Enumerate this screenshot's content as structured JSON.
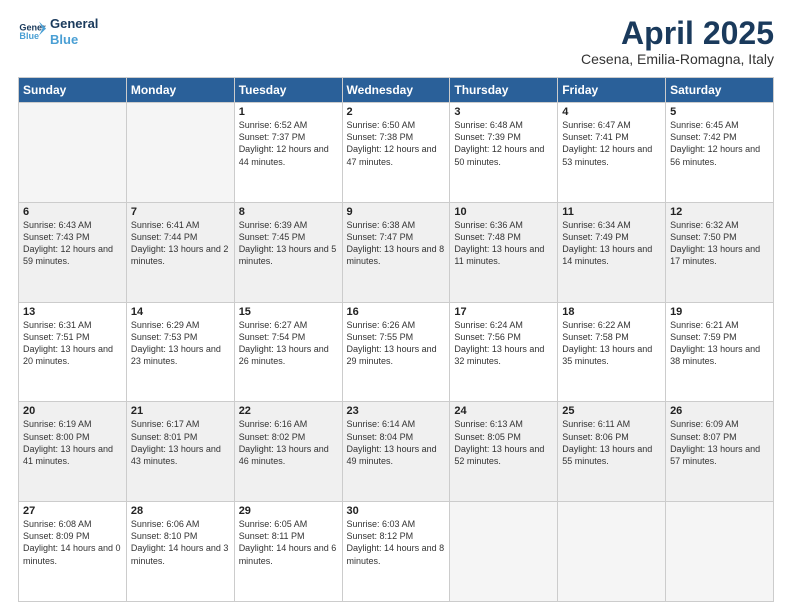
{
  "header": {
    "logo_general": "General",
    "logo_blue": "Blue",
    "month_title": "April 2025",
    "location": "Cesena, Emilia-Romagna, Italy"
  },
  "days_of_week": [
    "Sunday",
    "Monday",
    "Tuesday",
    "Wednesday",
    "Thursday",
    "Friday",
    "Saturday"
  ],
  "weeks": [
    [
      {
        "day": "",
        "info": ""
      },
      {
        "day": "",
        "info": ""
      },
      {
        "day": "1",
        "info": "Sunrise: 6:52 AM\nSunset: 7:37 PM\nDaylight: 12 hours and 44 minutes."
      },
      {
        "day": "2",
        "info": "Sunrise: 6:50 AM\nSunset: 7:38 PM\nDaylight: 12 hours and 47 minutes."
      },
      {
        "day": "3",
        "info": "Sunrise: 6:48 AM\nSunset: 7:39 PM\nDaylight: 12 hours and 50 minutes."
      },
      {
        "day": "4",
        "info": "Sunrise: 6:47 AM\nSunset: 7:41 PM\nDaylight: 12 hours and 53 minutes."
      },
      {
        "day": "5",
        "info": "Sunrise: 6:45 AM\nSunset: 7:42 PM\nDaylight: 12 hours and 56 minutes."
      }
    ],
    [
      {
        "day": "6",
        "info": "Sunrise: 6:43 AM\nSunset: 7:43 PM\nDaylight: 12 hours and 59 minutes."
      },
      {
        "day": "7",
        "info": "Sunrise: 6:41 AM\nSunset: 7:44 PM\nDaylight: 13 hours and 2 minutes."
      },
      {
        "day": "8",
        "info": "Sunrise: 6:39 AM\nSunset: 7:45 PM\nDaylight: 13 hours and 5 minutes."
      },
      {
        "day": "9",
        "info": "Sunrise: 6:38 AM\nSunset: 7:47 PM\nDaylight: 13 hours and 8 minutes."
      },
      {
        "day": "10",
        "info": "Sunrise: 6:36 AM\nSunset: 7:48 PM\nDaylight: 13 hours and 11 minutes."
      },
      {
        "day": "11",
        "info": "Sunrise: 6:34 AM\nSunset: 7:49 PM\nDaylight: 13 hours and 14 minutes."
      },
      {
        "day": "12",
        "info": "Sunrise: 6:32 AM\nSunset: 7:50 PM\nDaylight: 13 hours and 17 minutes."
      }
    ],
    [
      {
        "day": "13",
        "info": "Sunrise: 6:31 AM\nSunset: 7:51 PM\nDaylight: 13 hours and 20 minutes."
      },
      {
        "day": "14",
        "info": "Sunrise: 6:29 AM\nSunset: 7:53 PM\nDaylight: 13 hours and 23 minutes."
      },
      {
        "day": "15",
        "info": "Sunrise: 6:27 AM\nSunset: 7:54 PM\nDaylight: 13 hours and 26 minutes."
      },
      {
        "day": "16",
        "info": "Sunrise: 6:26 AM\nSunset: 7:55 PM\nDaylight: 13 hours and 29 minutes."
      },
      {
        "day": "17",
        "info": "Sunrise: 6:24 AM\nSunset: 7:56 PM\nDaylight: 13 hours and 32 minutes."
      },
      {
        "day": "18",
        "info": "Sunrise: 6:22 AM\nSunset: 7:58 PM\nDaylight: 13 hours and 35 minutes."
      },
      {
        "day": "19",
        "info": "Sunrise: 6:21 AM\nSunset: 7:59 PM\nDaylight: 13 hours and 38 minutes."
      }
    ],
    [
      {
        "day": "20",
        "info": "Sunrise: 6:19 AM\nSunset: 8:00 PM\nDaylight: 13 hours and 41 minutes."
      },
      {
        "day": "21",
        "info": "Sunrise: 6:17 AM\nSunset: 8:01 PM\nDaylight: 13 hours and 43 minutes."
      },
      {
        "day": "22",
        "info": "Sunrise: 6:16 AM\nSunset: 8:02 PM\nDaylight: 13 hours and 46 minutes."
      },
      {
        "day": "23",
        "info": "Sunrise: 6:14 AM\nSunset: 8:04 PM\nDaylight: 13 hours and 49 minutes."
      },
      {
        "day": "24",
        "info": "Sunrise: 6:13 AM\nSunset: 8:05 PM\nDaylight: 13 hours and 52 minutes."
      },
      {
        "day": "25",
        "info": "Sunrise: 6:11 AM\nSunset: 8:06 PM\nDaylight: 13 hours and 55 minutes."
      },
      {
        "day": "26",
        "info": "Sunrise: 6:09 AM\nSunset: 8:07 PM\nDaylight: 13 hours and 57 minutes."
      }
    ],
    [
      {
        "day": "27",
        "info": "Sunrise: 6:08 AM\nSunset: 8:09 PM\nDaylight: 14 hours and 0 minutes."
      },
      {
        "day": "28",
        "info": "Sunrise: 6:06 AM\nSunset: 8:10 PM\nDaylight: 14 hours and 3 minutes."
      },
      {
        "day": "29",
        "info": "Sunrise: 6:05 AM\nSunset: 8:11 PM\nDaylight: 14 hours and 6 minutes."
      },
      {
        "day": "30",
        "info": "Sunrise: 6:03 AM\nSunset: 8:12 PM\nDaylight: 14 hours and 8 minutes."
      },
      {
        "day": "",
        "info": ""
      },
      {
        "day": "",
        "info": ""
      },
      {
        "day": "",
        "info": ""
      }
    ]
  ]
}
